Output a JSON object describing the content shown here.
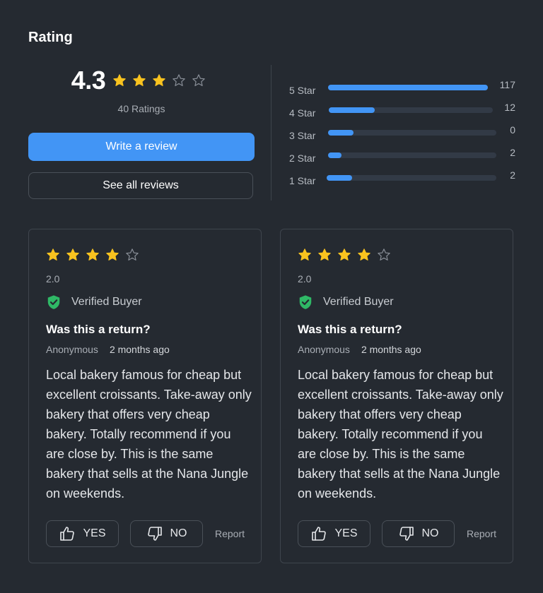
{
  "header": {
    "title": "Rating"
  },
  "summary": {
    "average": "4.3",
    "average_stars": 3,
    "max_stars": 5,
    "ratings_count": "40 Ratings",
    "write_review_label": "Write a review",
    "see_all_label": "See all reviews"
  },
  "distribution": [
    {
      "label": "5 Star",
      "count": "117",
      "fill": 1.0
    },
    {
      "label": "4 Star",
      "count": "12",
      "fill": 0.28
    },
    {
      "label": "3 Star",
      "count": "0",
      "fill": 0.15
    },
    {
      "label": "2 Star",
      "count": "2",
      "fill": 0.08
    },
    {
      "label": "1 Star",
      "count": "2",
      "fill": 0.15
    }
  ],
  "reviews": [
    {
      "stars": 4,
      "score": "2.0",
      "verified_label": "Verified Buyer",
      "title": "Was this a return?",
      "author": "Anonymous",
      "date": "2 months ago",
      "body": "Local bakery famous for cheap but excellent croissants. Take-away only bakery that offers very cheap bakery. Totally recommend if you are close by. This is the same bakery that sells at the Nana Jungle on weekends.",
      "yes_label": "YES",
      "no_label": "NO",
      "report_label": "Report"
    },
    {
      "stars": 4,
      "score": "2.0",
      "verified_label": "Verified Buyer",
      "title": "Was this a return?",
      "author": "Anonymous",
      "date": "2 months ago",
      "body": "Local bakery famous for cheap but excellent croissants. Take-away only bakery that offers very cheap bakery. Totally recommend if you are close by. This is the same bakery that sells at the Nana Jungle on weekends.",
      "yes_label": "YES",
      "no_label": "NO",
      "report_label": "Report"
    }
  ],
  "colors": {
    "background": "#252a31",
    "accent": "#4295f5",
    "star_filled": "#f9c31f",
    "star_empty": "#8a9099",
    "verified": "#2fb866"
  },
  "icons": {
    "star": "star-icon",
    "verified": "shield-check-icon",
    "thumbs_up": "thumbs-up-icon",
    "thumbs_down": "thumbs-down-icon"
  }
}
